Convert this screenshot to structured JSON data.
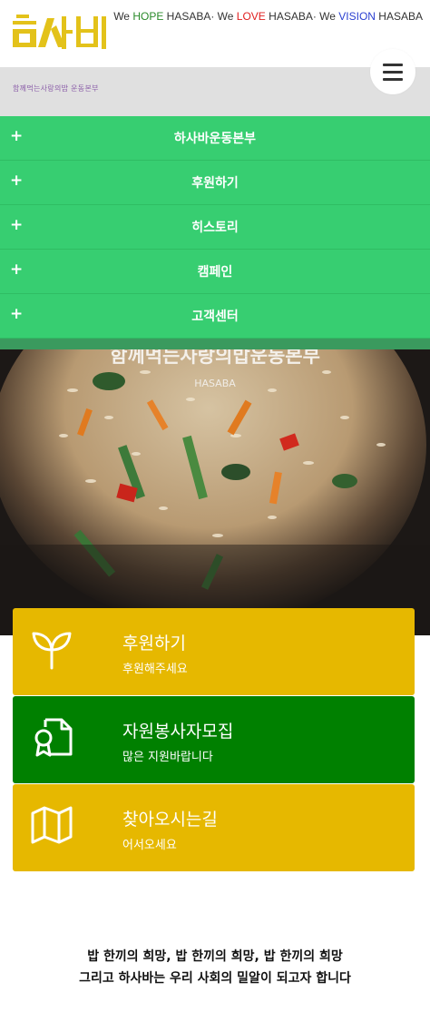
{
  "topbar": {
    "slogan_we1": "We ",
    "slogan_hope": "HOPE",
    "slogan_mid1": " HASABA· We ",
    "slogan_love": "LOVE",
    "slogan_mid2": " HASABA· We ",
    "slogan_vision": "VISION",
    "slogan_end": " HASABA"
  },
  "header": {
    "logo_text": "하사바",
    "logo_subtitle": "함께먹는사랑의밥 운동본부",
    "menu_icon": "hamburger-icon"
  },
  "nav": {
    "items": [
      {
        "label": "하사바운동본부",
        "icon": "plus-icon"
      },
      {
        "label": "후원하기",
        "icon": "plus-icon"
      },
      {
        "label": "히스토리",
        "icon": "plus-icon"
      },
      {
        "label": "캠페인",
        "icon": "plus-icon"
      },
      {
        "label": "고객센터",
        "icon": "plus-icon"
      }
    ]
  },
  "hero": {
    "title": "함께먹는사랑의밥운동본부",
    "subtitle": "HASABA"
  },
  "cards": [
    {
      "title": "후원하기",
      "subtitle": "후원해주세요",
      "icon": "sprout-icon",
      "color": "#e6b800"
    },
    {
      "title": "자원봉사자모집",
      "subtitle": "많은 지원바랍니다",
      "icon": "certificate-document-icon",
      "color": "#008000"
    },
    {
      "title": "찾아오시는길",
      "subtitle": "어서오세요",
      "icon": "map-icon",
      "color": "#e6b800"
    }
  ],
  "footer_text": {
    "line1": "밥 한끼의 희망, 밥 한끼의 희망, 밥 한끼의 희망",
    "line2": "그리고 하사바는 우리 사회의 밀알이 되고자 합니다"
  },
  "colors": {
    "nav_green": "#37ce71",
    "card_yellow": "#e6b800",
    "card_green": "#008000"
  }
}
